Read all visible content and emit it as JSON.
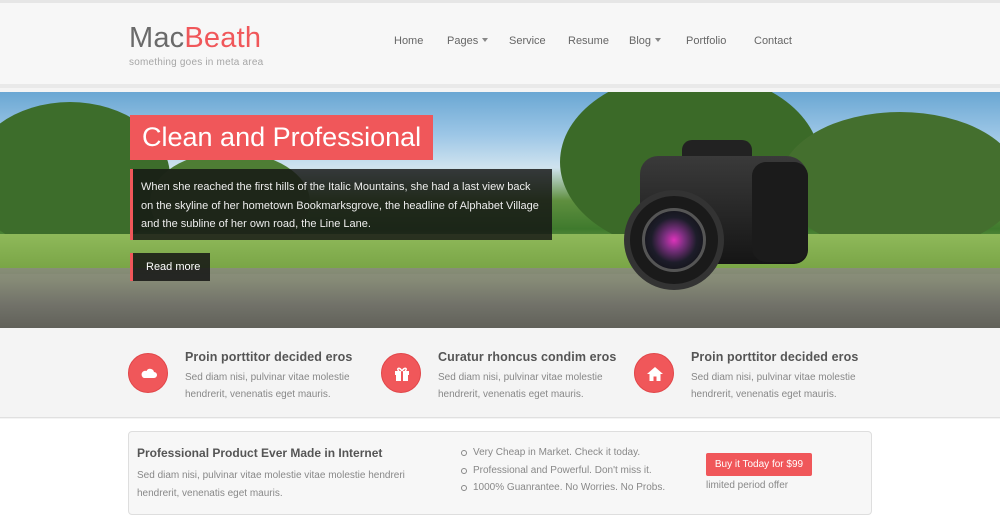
{
  "header": {
    "logo_part1": "Mac",
    "logo_part2": "Beath",
    "tagline": "something goes in meta area",
    "nav": [
      {
        "label": "Home"
      },
      {
        "label": "Pages"
      },
      {
        "label": "Service"
      },
      {
        "label": "Resume"
      },
      {
        "label": "Blog"
      },
      {
        "label": "Portfolio"
      },
      {
        "label": "Contact"
      }
    ]
  },
  "hero": {
    "title": "Clean and Professional",
    "text": "When she reached the first hills of the Italic Mountains, she had a last view back on the skyline of her hometown Bookmarksgrove, the headline of Alphabet Village and the subline of her own road, the Line Lane.",
    "button": "Read more"
  },
  "features": [
    {
      "icon": "cloud-icon",
      "title": "Proin porttitor decided eros",
      "desc": "Sed diam nisi, pulvinar vitae molestie hendrerit, venenatis eget mauris."
    },
    {
      "icon": "gift-icon",
      "title": "Curatur rhoncus condim eros",
      "desc": "Sed diam nisi, pulvinar vitae molestie hendrerit, venenatis eget mauris."
    },
    {
      "icon": "home-icon",
      "title": "Proin porttitor decided eros",
      "desc": "Sed diam nisi, pulvinar vitae molestie hendrerit, venenatis eget mauris."
    }
  ],
  "promo": {
    "title": "Professional Product Ever Made in Internet",
    "desc": "Sed diam nisi, pulvinar vitae molestie vitae molestie hendreri hendrerit, venenatis eget mauris.",
    "list": [
      "Very Cheap in Market. Check it today.",
      "Professional and Powerful. Don't miss it.",
      "1000% Guanrantee. No Worries. No Probs."
    ],
    "button": "Buy it Today for $99",
    "offer": "limited period offer"
  },
  "colors": {
    "accent": "#f0575a",
    "text": "#777777",
    "heading": "#555555"
  }
}
